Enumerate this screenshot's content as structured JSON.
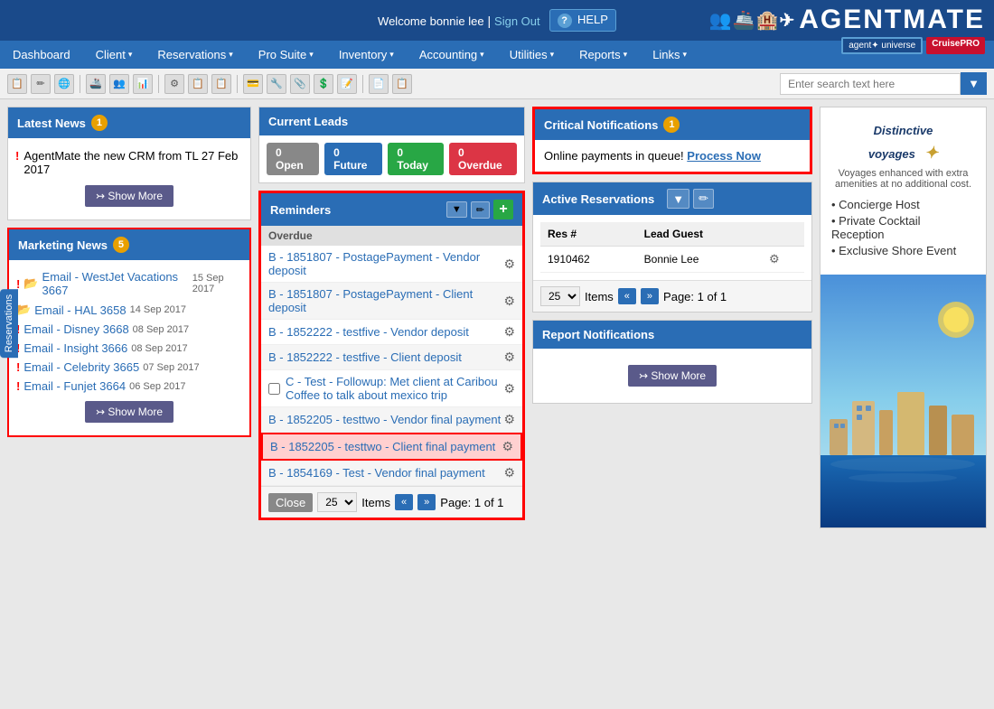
{
  "header": {
    "welcome": "Welcome bonnie lee",
    "sign_out": "Sign Out",
    "help": "HELP"
  },
  "nav": {
    "items": [
      "Dashboard",
      "Client",
      "Reservations",
      "Pro Suite",
      "Inventory",
      "Accounting",
      "Utilities",
      "Reports",
      "Links"
    ]
  },
  "latest_news": {
    "title": "Latest News",
    "badge": "1",
    "items": [
      {
        "text": "AgentMate the new CRM from TL 27 Feb 2017",
        "excl": true
      }
    ],
    "show_more": "Show More"
  },
  "marketing_news": {
    "title": "Marketing News",
    "badge": "5",
    "items": [
      {
        "excl": true,
        "folder": true,
        "link": "Email - WestJet Vacations 3667",
        "date": "15 Sep 2017"
      },
      {
        "excl": false,
        "folder": true,
        "link": "Email - HAL 3658",
        "date": "14 Sep 2017"
      },
      {
        "excl": true,
        "folder": false,
        "link": "Email - Disney 3668",
        "date": "08 Sep 2017"
      },
      {
        "excl": true,
        "folder": false,
        "link": "Email - Insight 3666",
        "date": "08 Sep 2017"
      },
      {
        "excl": true,
        "folder": false,
        "link": "Email - Celebrity 3665",
        "date": "07 Sep 2017"
      },
      {
        "excl": true,
        "folder": false,
        "link": "Email - Funjet 3664",
        "date": "06 Sep 2017"
      }
    ],
    "show_more": "Show More"
  },
  "current_leads": {
    "title": "Current Leads",
    "badges": [
      {
        "label": "0 Open",
        "color": "gray"
      },
      {
        "label": "0 Future",
        "color": "blue"
      },
      {
        "label": "0 Today",
        "color": "green"
      },
      {
        "label": "0 Overdue",
        "color": "red"
      }
    ]
  },
  "reminders": {
    "title": "Reminders",
    "section": "Overdue",
    "items": [
      {
        "text": "B - 1851807 - PostagePayment - Vendor deposit",
        "highlighted": false
      },
      {
        "text": "B - 1851807 - PostagePayment - Client deposit",
        "highlighted": false
      },
      {
        "text": "B - 1852222 - testfive - Vendor deposit",
        "highlighted": false
      },
      {
        "text": "B - 1852222 - testfive - Client deposit",
        "highlighted": false
      },
      {
        "text": "C - Test - Followup: Met client at Caribou Coffee to talk about mexico trip",
        "highlighted": false,
        "checkbox": true
      },
      {
        "text": "B - 1852205 - testtwo - Vendor final payment",
        "highlighted": false
      },
      {
        "text": "B - 1852205 - testtwo - Client final payment",
        "highlighted": true
      },
      {
        "text": "B - 1854169 - Test - Vendor final payment",
        "highlighted": false
      }
    ],
    "pagination": {
      "close": "Close",
      "items_per_page": "25",
      "items_label": "Items",
      "page_info": "Page: 1 of 1"
    }
  },
  "critical_notifications": {
    "title": "Critical Notifications",
    "badge": "1",
    "message": "Online payments in queue!",
    "action": "Process Now"
  },
  "active_reservations": {
    "title": "Active Reservations",
    "columns": [
      "Res #",
      "Lead Guest"
    ],
    "rows": [
      {
        "res": "1910462",
        "guest": "Bonnie Lee"
      }
    ],
    "pagination": {
      "items_per_page": "25",
      "items_label": "Items",
      "page_info": "Page: 1 of 1"
    }
  },
  "report_notifications": {
    "title": "Report Notifications",
    "show_more": "Show More"
  },
  "ad": {
    "title": "Distinctive voyages",
    "subtitle": "Voyages enhanced with extra amenities at no additional cost.",
    "features": [
      "• Concierge Host",
      "• Private Cocktail Reception",
      "• Exclusive Shore Event"
    ]
  },
  "search": {
    "placeholder": "Enter search text here"
  },
  "side_tab": "Reservations"
}
